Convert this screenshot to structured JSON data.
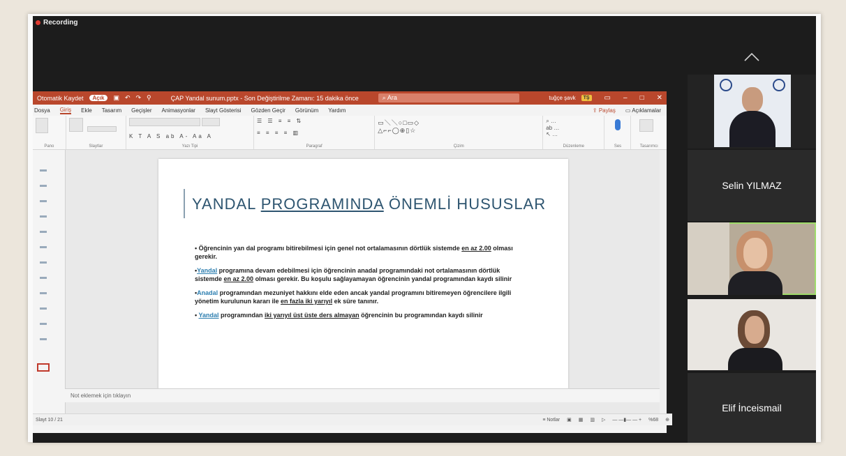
{
  "meeting": {
    "recording_label": "Recording"
  },
  "ppt": {
    "autosave_label": "Otomatik Kaydet",
    "autosave_state": "Açık",
    "file_title": "ÇAP Yandal sunum.pptx - Son Değiştirilme Zamanı: 15 dakika önce",
    "search_placeholder": "Ara",
    "user_name": "tuğçe şavk",
    "user_initials": "TŞ",
    "tabs": [
      "Dosya",
      "Giriş",
      "Ekle",
      "Tasarım",
      "Geçişler",
      "Animasyonlar",
      "Slayt Gösterisi",
      "Gözden Geçir",
      "Görünüm",
      "Yardım"
    ],
    "active_tab": "Giriş",
    "share_label": "Paylaş",
    "comments_label": "Açıklamalar",
    "ribbon_groups": [
      "Pano",
      "Slaytlar",
      "Yazı Tipi",
      "Paragraf",
      "Çizim",
      "Düzenleme",
      "Ses",
      "Tasarımcı"
    ],
    "notes_placeholder": "Not eklemek için tıklayın",
    "slide_counter": "Slayt 10 / 21",
    "notes_button": "Notlar",
    "zoom": "%68"
  },
  "slide": {
    "title_part1": "YANDAL ",
    "title_underlined": "PROGRAMINDA",
    "title_part2": " ÖNEMLİ HUSUSLAR",
    "bullets": [
      {
        "prefix": "",
        "text1": "Öğrencinin yan dal programı bitirebilmesi için genel not ortalamasının dörtlük sistemde ",
        "emph": "en az 2.00",
        "text2": " olması gerekir."
      },
      {
        "prefix": "Yandal",
        "text1": " programına devam edebilmesi için öğrencinin anadal programındaki not ortalamasının dörtlük sistemde ",
        "emph": "en az 2.00",
        "text2": " olması gerekir. Bu koşulu sağlayamayan öğrencinin yandal programından kaydı silinir"
      },
      {
        "prefix": "Anadal",
        "text1": " programından mezuniyet hakkını elde eden ancak yandal programını bitiremeyen öğrencilere ilgili yönetim kurulunun kararı ile ",
        "emph": "en fazla iki yarıyıl",
        "text2": " ek süre tanınır."
      },
      {
        "prefix": "Yandal",
        "text1": " programından ",
        "emph": "iki yarıyıl üst üste ders almayan",
        "text2": " öğrencinin bu programından kaydı silinir"
      }
    ]
  },
  "participants": [
    {
      "name": "",
      "type": "video"
    },
    {
      "name": "Selin YILMAZ",
      "type": "name"
    },
    {
      "name": "",
      "type": "video",
      "active": true
    },
    {
      "name": "",
      "type": "video"
    },
    {
      "name": "Elif İnceismail",
      "type": "name"
    }
  ]
}
